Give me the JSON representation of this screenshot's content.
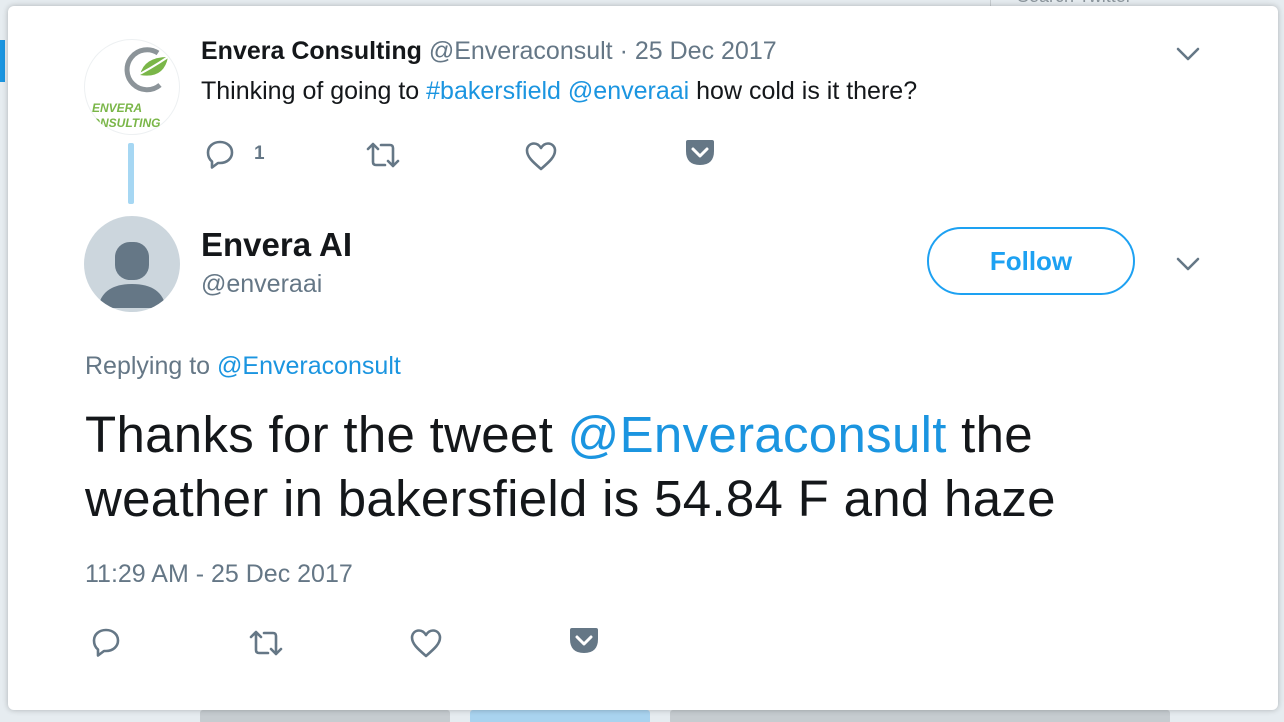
{
  "background": {
    "search_placeholder": "Search Twitter"
  },
  "parent_tweet": {
    "author_name": "Envera Consulting",
    "author_handle": "@Enveraconsult",
    "date_separator": " · ",
    "date": "25 Dec 2017",
    "text_before": "Thinking of going to ",
    "hashtag": "#bakersfield",
    "text_between": " ",
    "mention": "@enveraai",
    "text_after": " how cold is it there?",
    "reply_count": "1",
    "avatar_logo_text_1": "ENVERA",
    "avatar_logo_text_2": "CONSULTING",
    "icons": [
      "reply-icon",
      "retweet-icon",
      "like-icon",
      "save-to-pocket-icon",
      "chevron-down-icon"
    ]
  },
  "main_tweet": {
    "author_name": "Envera AI",
    "author_handle": "@enveraai",
    "follow_label": "Follow",
    "replying_prefix": "Replying to ",
    "replying_to": "@Enveraconsult",
    "text_before": "Thanks for the tweet ",
    "mention": "@Enveraconsult",
    "text_after": " the weather in bakersfield is 54.84 F and haze",
    "timestamp": "11:29 AM - 25 Dec 2017",
    "icons": [
      "reply-icon",
      "retweet-icon",
      "like-icon",
      "save-to-pocket-icon",
      "chevron-down-icon"
    ]
  },
  "colors": {
    "link": "#1b95e0",
    "follow": "#1da1f2",
    "muted": "#657786",
    "text": "#14171a",
    "thread_line": "#a6d7f3",
    "logo_green": "#7ab648"
  }
}
